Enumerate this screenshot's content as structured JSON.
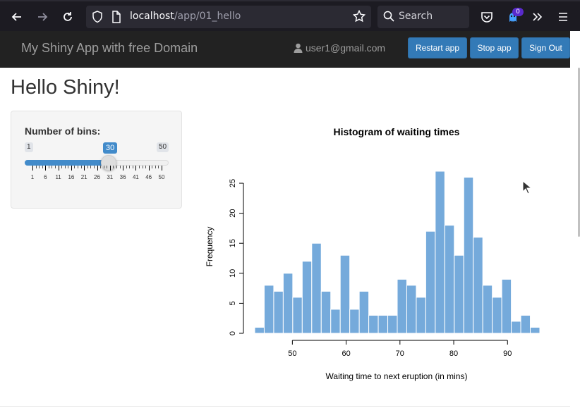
{
  "browser": {
    "url_host": "localhost",
    "url_path": "/app/01_hello",
    "search_placeholder": "Search",
    "extension_badge": "0"
  },
  "app": {
    "title": "My Shiny App with free Domain",
    "user": "user1@gmail.com",
    "buttons": {
      "restart": "Restart app",
      "stop": "Stop app",
      "signout": "Sign Out"
    },
    "accent": "#337ab7"
  },
  "page": {
    "title": "Hello Shiny!"
  },
  "slider": {
    "label": "Number of bins:",
    "min": "1",
    "max": "50",
    "value": "30",
    "grid_labels": [
      "1",
      "6",
      "11",
      "16",
      "21",
      "26",
      "31",
      "36",
      "41",
      "46",
      "50"
    ]
  },
  "chart_data": {
    "type": "bar",
    "title": "Histogram of waiting times",
    "xlabel": "Waiting time to next eruption (in mins)",
    "ylabel": "Frequency",
    "bar_color": "#75AADB",
    "x_ticks": [
      "50",
      "60",
      "70",
      "80",
      "90"
    ],
    "y_ticks": [
      "0",
      "5",
      "10",
      "15",
      "20",
      "25"
    ],
    "xlim": [
      43,
      96
    ],
    "ylim": [
      0,
      27
    ],
    "bin_start": 43,
    "bin_width": 1.7667,
    "values": [
      1,
      8,
      7,
      10,
      6,
      12,
      15,
      7,
      4,
      13,
      4,
      7,
      3,
      3,
      3,
      9,
      8,
      6,
      17,
      27,
      18,
      13,
      26,
      16,
      8,
      6,
      9,
      2,
      3,
      1
    ]
  }
}
